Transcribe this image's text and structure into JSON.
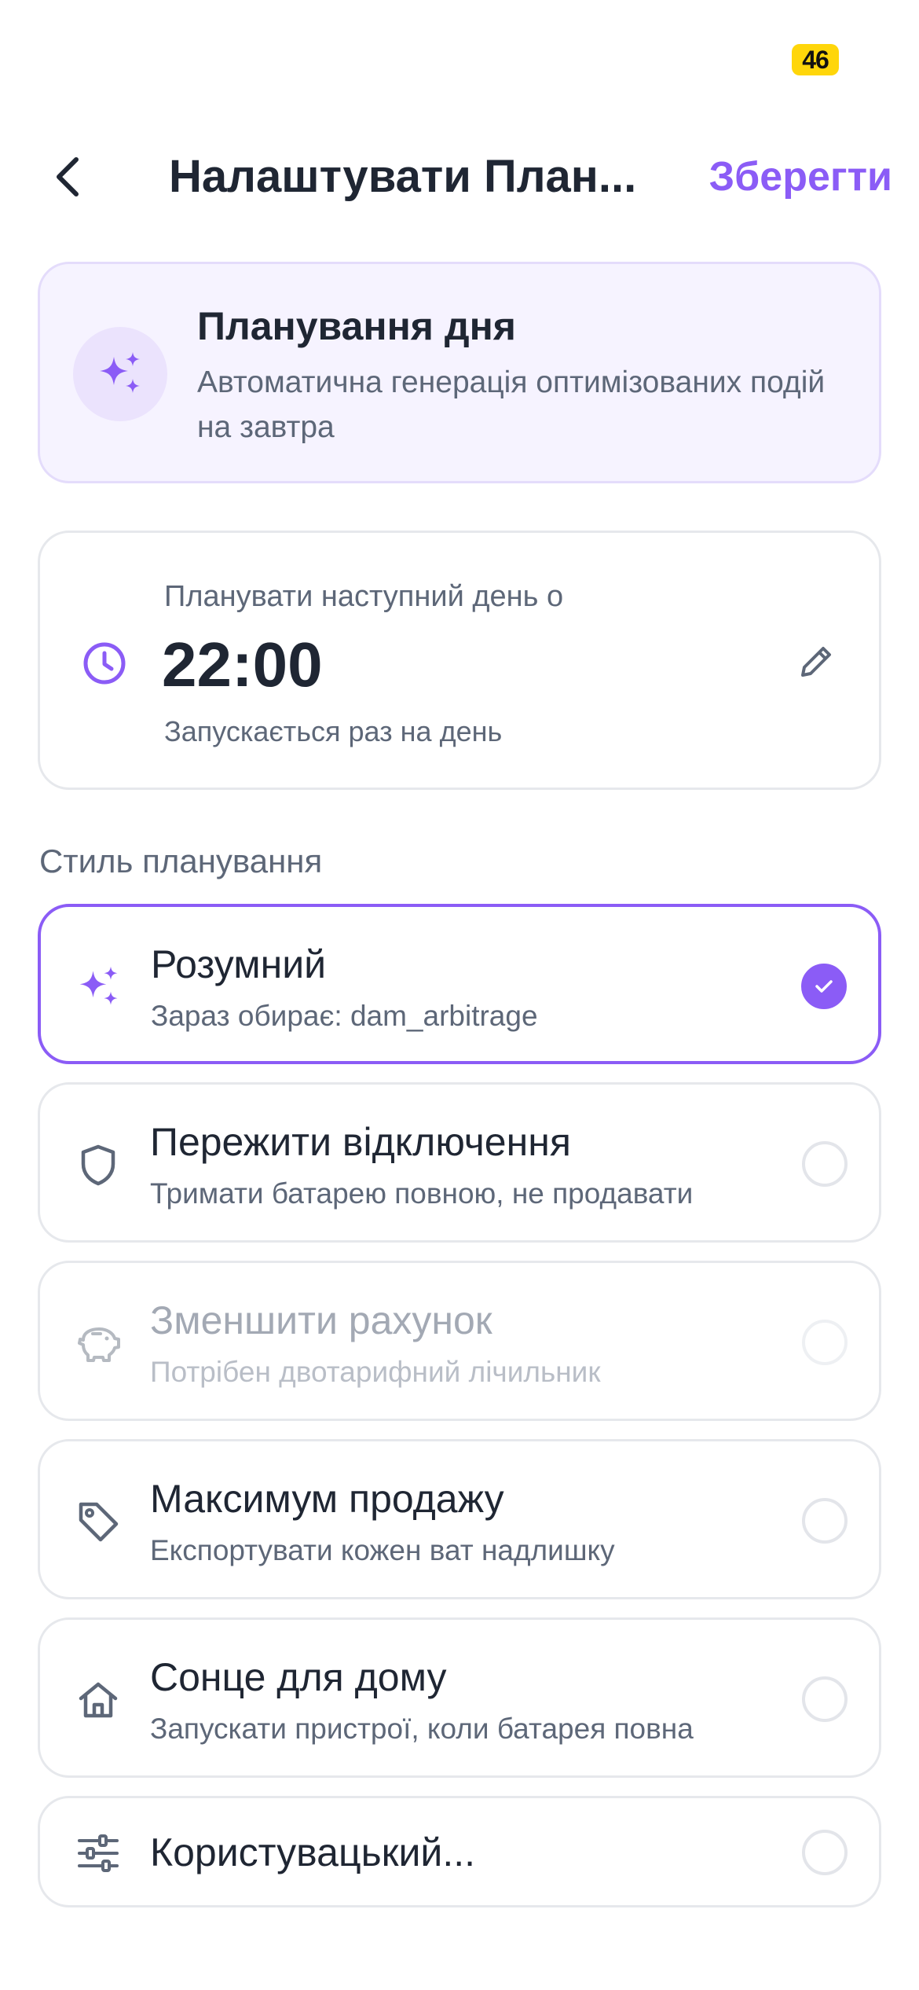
{
  "status_bar": {
    "battery": "46"
  },
  "header": {
    "title": "Налаштувати План...",
    "save_label": "Зберегти"
  },
  "hero": {
    "title": "Планування дня",
    "subtitle": "Автоматична генерація оптимізованих подій на завтра",
    "icon": "sparkles-icon"
  },
  "schedule": {
    "label": "Планувати наступний день о",
    "time": "22:00",
    "note": "Запускається раз на день",
    "icon": "clock-icon"
  },
  "section_label": "Стиль планування",
  "options": [
    {
      "title": "Розумний",
      "subtitle": "Зараз обирає: dam_arbitrage",
      "icon": "sparkles-icon",
      "state": "selected"
    },
    {
      "title": "Пережити відключення",
      "subtitle": "Тримати батарею повною, не продавати",
      "icon": "shield-icon",
      "state": "normal"
    },
    {
      "title": "Зменшити рахунок",
      "subtitle": "Потрібен двотарифний лічильник",
      "icon": "piggy-bank-icon",
      "state": "disabled"
    },
    {
      "title": "Максимум продажу",
      "subtitle": "Експортувати кожен ват надлишку",
      "icon": "tag-icon",
      "state": "normal"
    },
    {
      "title": "Сонце для дому",
      "subtitle": "Запускати пристрої, коли батарея повна",
      "icon": "home-icon",
      "state": "normal"
    },
    {
      "title": "Користувацький...",
      "subtitle": "",
      "icon": "sliders-icon",
      "state": "normal"
    }
  ],
  "colors": {
    "accent": "#8b5cf6",
    "text": "#1f2633",
    "muted": "#5d6778",
    "battery": "#ffd60a"
  }
}
